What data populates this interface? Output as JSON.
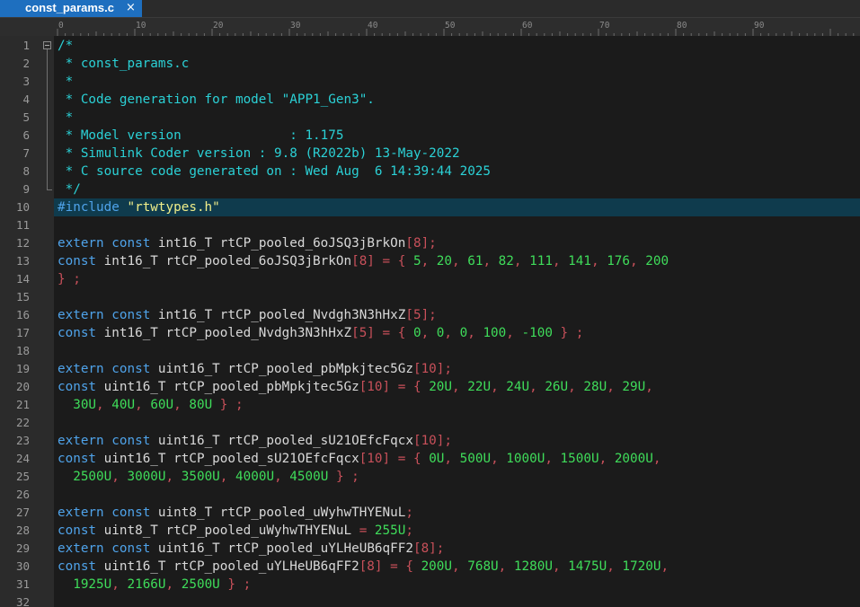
{
  "tab": {
    "title": "const_params.c",
    "close_glyph": "×",
    "close_icon": "close-icon"
  },
  "ruler": {
    "labels": [
      "0",
      "10",
      "20",
      "30",
      "40",
      "50",
      "60",
      "70",
      "80",
      "90"
    ]
  },
  "editor": {
    "highlighted_line": 10,
    "fold_marker_line": 1,
    "colors": {
      "background": "#1b1b1b",
      "comment": "#2bd1d6",
      "keyword": "#4fa3ea",
      "string": "#f0ee8a",
      "number": "#3fdc5a",
      "operator": "#c8505a",
      "text": "#d8d8d8",
      "current_line": "#0f3b4d",
      "tab_active": "#1e6fbf"
    },
    "lines": [
      [
        [
          "com",
          "/*"
        ]
      ],
      [
        [
          "com",
          " * const_params.c"
        ]
      ],
      [
        [
          "com",
          " *"
        ]
      ],
      [
        [
          "com",
          " * Code generation for model \"APP1_Gen3\"."
        ]
      ],
      [
        [
          "com",
          " *"
        ]
      ],
      [
        [
          "com",
          " * Model version              : 1.175"
        ]
      ],
      [
        [
          "com",
          " * Simulink Coder version : 9.8 (R2022b) 13-May-2022"
        ]
      ],
      [
        [
          "com",
          " * C source code generated on : Wed Aug  6 14:39:44 2025"
        ]
      ],
      [
        [
          "com",
          " */"
        ]
      ],
      [
        [
          "pp",
          "#include"
        ],
        [
          "txt",
          " "
        ],
        [
          "str",
          "\"rtwtypes.h\""
        ]
      ],
      [],
      [
        [
          "kw",
          "extern"
        ],
        [
          "txt",
          " "
        ],
        [
          "kw",
          "const"
        ],
        [
          "txt",
          " int16_T rtCP_pooled_6oJSQ3jBrkOn"
        ],
        [
          "op",
          "[8];"
        ]
      ],
      [
        [
          "kw",
          "const"
        ],
        [
          "txt",
          " int16_T rtCP_pooled_6oJSQ3jBrkOn"
        ],
        [
          "op",
          "[8] = {"
        ],
        [
          "txt",
          " "
        ],
        [
          "num",
          "5"
        ],
        [
          "op",
          ","
        ],
        [
          "txt",
          " "
        ],
        [
          "num",
          "20"
        ],
        [
          "op",
          ","
        ],
        [
          "txt",
          " "
        ],
        [
          "num",
          "61"
        ],
        [
          "op",
          ","
        ],
        [
          "txt",
          " "
        ],
        [
          "num",
          "82"
        ],
        [
          "op",
          ","
        ],
        [
          "txt",
          " "
        ],
        [
          "num",
          "111"
        ],
        [
          "op",
          ","
        ],
        [
          "txt",
          " "
        ],
        [
          "num",
          "141"
        ],
        [
          "op",
          ","
        ],
        [
          "txt",
          " "
        ],
        [
          "num",
          "176"
        ],
        [
          "op",
          ","
        ],
        [
          "txt",
          " "
        ],
        [
          "num",
          "200"
        ]
      ],
      [
        [
          "op",
          "} ;"
        ]
      ],
      [],
      [
        [
          "kw",
          "extern"
        ],
        [
          "txt",
          " "
        ],
        [
          "kw",
          "const"
        ],
        [
          "txt",
          " int16_T rtCP_pooled_Nvdgh3N3hHxZ"
        ],
        [
          "op",
          "[5];"
        ]
      ],
      [
        [
          "kw",
          "const"
        ],
        [
          "txt",
          " int16_T rtCP_pooled_Nvdgh3N3hHxZ"
        ],
        [
          "op",
          "[5] = {"
        ],
        [
          "txt",
          " "
        ],
        [
          "num",
          "0"
        ],
        [
          "op",
          ","
        ],
        [
          "txt",
          " "
        ],
        [
          "num",
          "0"
        ],
        [
          "op",
          ","
        ],
        [
          "txt",
          " "
        ],
        [
          "num",
          "0"
        ],
        [
          "op",
          ","
        ],
        [
          "txt",
          " "
        ],
        [
          "num",
          "100"
        ],
        [
          "op",
          ","
        ],
        [
          "txt",
          " "
        ],
        [
          "num",
          "-100"
        ],
        [
          "txt",
          " "
        ],
        [
          "op",
          "} ;"
        ]
      ],
      [],
      [
        [
          "kw",
          "extern"
        ],
        [
          "txt",
          " "
        ],
        [
          "kw",
          "const"
        ],
        [
          "txt",
          " uint16_T rtCP_pooled_pbMpkjtec5Gz"
        ],
        [
          "op",
          "[10];"
        ]
      ],
      [
        [
          "kw",
          "const"
        ],
        [
          "txt",
          " uint16_T rtCP_pooled_pbMpkjtec5Gz"
        ],
        [
          "op",
          "[10] = {"
        ],
        [
          "txt",
          " "
        ],
        [
          "num",
          "20U"
        ],
        [
          "op",
          ","
        ],
        [
          "txt",
          " "
        ],
        [
          "num",
          "22U"
        ],
        [
          "op",
          ","
        ],
        [
          "txt",
          " "
        ],
        [
          "num",
          "24U"
        ],
        [
          "op",
          ","
        ],
        [
          "txt",
          " "
        ],
        [
          "num",
          "26U"
        ],
        [
          "op",
          ","
        ],
        [
          "txt",
          " "
        ],
        [
          "num",
          "28U"
        ],
        [
          "op",
          ","
        ],
        [
          "txt",
          " "
        ],
        [
          "num",
          "29U"
        ],
        [
          "op",
          ","
        ]
      ],
      [
        [
          "txt",
          "  "
        ],
        [
          "num",
          "30U"
        ],
        [
          "op",
          ","
        ],
        [
          "txt",
          " "
        ],
        [
          "num",
          "40U"
        ],
        [
          "op",
          ","
        ],
        [
          "txt",
          " "
        ],
        [
          "num",
          "60U"
        ],
        [
          "op",
          ","
        ],
        [
          "txt",
          " "
        ],
        [
          "num",
          "80U"
        ],
        [
          "txt",
          " "
        ],
        [
          "op",
          "} ;"
        ]
      ],
      [],
      [
        [
          "kw",
          "extern"
        ],
        [
          "txt",
          " "
        ],
        [
          "kw",
          "const"
        ],
        [
          "txt",
          " uint16_T rtCP_pooled_sU21OEfcFqcx"
        ],
        [
          "op",
          "[10];"
        ]
      ],
      [
        [
          "kw",
          "const"
        ],
        [
          "txt",
          " uint16_T rtCP_pooled_sU21OEfcFqcx"
        ],
        [
          "op",
          "[10] = {"
        ],
        [
          "txt",
          " "
        ],
        [
          "num",
          "0U"
        ],
        [
          "op",
          ","
        ],
        [
          "txt",
          " "
        ],
        [
          "num",
          "500U"
        ],
        [
          "op",
          ","
        ],
        [
          "txt",
          " "
        ],
        [
          "num",
          "1000U"
        ],
        [
          "op",
          ","
        ],
        [
          "txt",
          " "
        ],
        [
          "num",
          "1500U"
        ],
        [
          "op",
          ","
        ],
        [
          "txt",
          " "
        ],
        [
          "num",
          "2000U"
        ],
        [
          "op",
          ","
        ]
      ],
      [
        [
          "txt",
          "  "
        ],
        [
          "num",
          "2500U"
        ],
        [
          "op",
          ","
        ],
        [
          "txt",
          " "
        ],
        [
          "num",
          "3000U"
        ],
        [
          "op",
          ","
        ],
        [
          "txt",
          " "
        ],
        [
          "num",
          "3500U"
        ],
        [
          "op",
          ","
        ],
        [
          "txt",
          " "
        ],
        [
          "num",
          "4000U"
        ],
        [
          "op",
          ","
        ],
        [
          "txt",
          " "
        ],
        [
          "num",
          "4500U"
        ],
        [
          "txt",
          " "
        ],
        [
          "op",
          "} ;"
        ]
      ],
      [],
      [
        [
          "kw",
          "extern"
        ],
        [
          "txt",
          " "
        ],
        [
          "kw",
          "const"
        ],
        [
          "txt",
          " uint8_T rtCP_pooled_uWyhwTHYENuL"
        ],
        [
          "op",
          ";"
        ]
      ],
      [
        [
          "kw",
          "const"
        ],
        [
          "txt",
          " uint8_T rtCP_pooled_uWyhwTHYENuL"
        ],
        [
          "txt",
          " "
        ],
        [
          "op",
          "="
        ],
        [
          "txt",
          " "
        ],
        [
          "num",
          "255U"
        ],
        [
          "op",
          ";"
        ]
      ],
      [
        [
          "kw",
          "extern"
        ],
        [
          "txt",
          " "
        ],
        [
          "kw",
          "const"
        ],
        [
          "txt",
          " uint16_T rtCP_pooled_uYLHeUB6qFF2"
        ],
        [
          "op",
          "[8];"
        ]
      ],
      [
        [
          "kw",
          "const"
        ],
        [
          "txt",
          " uint16_T rtCP_pooled_uYLHeUB6qFF2"
        ],
        [
          "op",
          "[8] = {"
        ],
        [
          "txt",
          " "
        ],
        [
          "num",
          "200U"
        ],
        [
          "op",
          ","
        ],
        [
          "txt",
          " "
        ],
        [
          "num",
          "768U"
        ],
        [
          "op",
          ","
        ],
        [
          "txt",
          " "
        ],
        [
          "num",
          "1280U"
        ],
        [
          "op",
          ","
        ],
        [
          "txt",
          " "
        ],
        [
          "num",
          "1475U"
        ],
        [
          "op",
          ","
        ],
        [
          "txt",
          " "
        ],
        [
          "num",
          "1720U"
        ],
        [
          "op",
          ","
        ]
      ],
      [
        [
          "txt",
          "  "
        ],
        [
          "num",
          "1925U"
        ],
        [
          "op",
          ","
        ],
        [
          "txt",
          " "
        ],
        [
          "num",
          "2166U"
        ],
        [
          "op",
          ","
        ],
        [
          "txt",
          " "
        ],
        [
          "num",
          "2500U"
        ],
        [
          "txt",
          " "
        ],
        [
          "op",
          "} ;"
        ]
      ],
      []
    ]
  }
}
